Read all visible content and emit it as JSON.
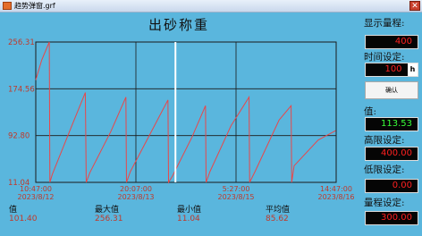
{
  "window": {
    "title": "趋势弹窗.grf",
    "close_glyph": "✕"
  },
  "chart_data": {
    "type": "line",
    "title": "出砂称重",
    "y_ticks": [
      "256.31",
      "174.56",
      "92.80",
      "11.04"
    ],
    "ylim": [
      11.04,
      256.31
    ],
    "x_ticks": [
      {
        "time": "10:47:00",
        "date": "2023/8/12"
      },
      {
        "time": "20:07:00",
        "date": "2023/8/13"
      },
      {
        "time": "5:27:00",
        "date": "2023/8/15"
      },
      {
        "time": "14:47:00",
        "date": "2023/8/16"
      }
    ],
    "series": [
      {
        "color": "#e8474a",
        "x": [
          0,
          0.02,
          0.045,
          0.047,
          0.055,
          0.12,
          0.165,
          0.168,
          0.18,
          0.25,
          0.3,
          0.302,
          0.315,
          0.39,
          0.44,
          0.442,
          0.455,
          0.52,
          0.565,
          0.567,
          0.58,
          0.65,
          0.71,
          0.712,
          0.73,
          0.81,
          0.85,
          0.852,
          0.86,
          0.94,
          0.998
        ],
        "y": [
          190,
          225,
          256.31,
          11.04,
          25,
          110,
          168,
          11.04,
          28,
          100,
          160,
          11.04,
          30,
          105,
          155,
          11.04,
          22,
          90,
          145,
          11.04,
          30,
          110,
          160,
          11.04,
          30,
          120,
          145,
          11.04,
          40,
          85,
          101.4
        ]
      }
    ],
    "cursor_x": 0.465
  },
  "stats": [
    {
      "label": "值",
      "value": "101.40"
    },
    {
      "label": "最大值",
      "value": "256.31"
    },
    {
      "label": "最小值",
      "value": "11.04"
    },
    {
      "label": "平均值",
      "value": "85.62"
    }
  ],
  "panel": {
    "display_range_label": "显示量程:",
    "display_range_value": "400",
    "time_setting_label": "时间设定:",
    "time_setting_value": "100",
    "time_unit": "h",
    "confirm_label": "确认",
    "value_label": "值:",
    "current_value": "113.53",
    "high_limit_label": "高限设定:",
    "high_limit_value": "400.00",
    "low_limit_label": "低限设定:",
    "low_limit_value": "0.00",
    "range_setting_label": "量程设定:",
    "range_setting_value": "300.00"
  }
}
